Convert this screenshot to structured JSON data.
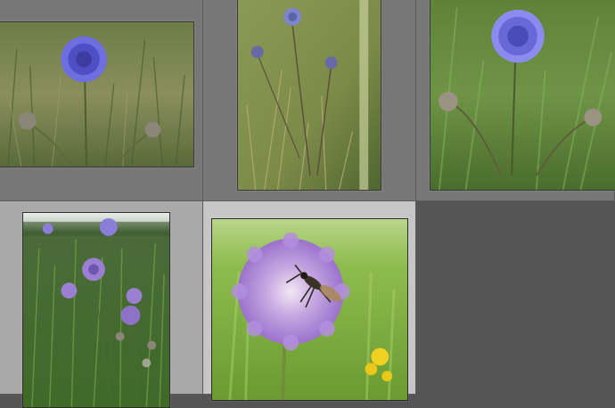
{
  "colors": {
    "cell_default": "#777777",
    "cell_selected_row2": "#a9a9a9",
    "cell_active": "#c6c6c6",
    "workspace": "#555555"
  },
  "grid": {
    "cells": [
      {
        "name": "thumbnail-cell-1",
        "state": "default",
        "photo": "scabiosa-single-head-meadow",
        "orientation": "landscape"
      },
      {
        "name": "thumbnail-cell-2",
        "state": "default",
        "photo": "scabiosa-buds-dry-grass",
        "orientation": "portrait"
      },
      {
        "name": "thumbnail-cell-3",
        "state": "default",
        "photo": "scabiosa-closeup-green-grass",
        "orientation": "portrait"
      },
      {
        "name": "thumbnail-cell-4",
        "state": "highlighted",
        "photo": "scabiosa-meadow-many-flowers",
        "orientation": "portrait"
      },
      {
        "name": "thumbnail-cell-5",
        "state": "selected",
        "photo": "scabiosa-flower-with-insect",
        "orientation": "portrait"
      }
    ]
  }
}
